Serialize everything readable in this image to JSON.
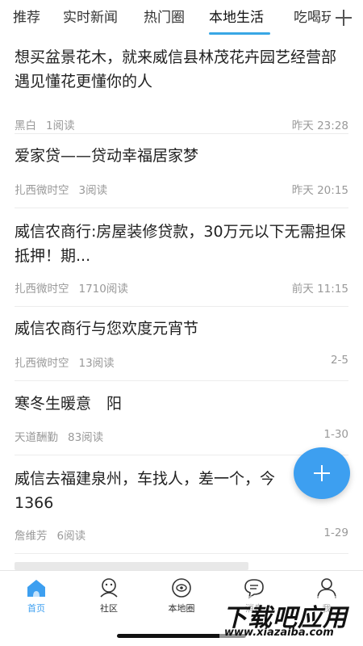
{
  "tabs": [
    {
      "label": "推荐"
    },
    {
      "label": "实时新闻"
    },
    {
      "label": "热门圈"
    },
    {
      "label": "本地生活",
      "active": true
    },
    {
      "label": "吃喝玩"
    }
  ],
  "feed": [
    {
      "title": "想买盆景花木，就来威信县林茂花卉园艺经营部遇见懂花更懂你的人",
      "author": "黑白",
      "views": "1阅读",
      "time": "昨天 23:28"
    },
    {
      "title": "爱家贷——贷动幸福居家梦",
      "author": "扎西微时空",
      "views": "3阅读",
      "time": "昨天 20:15"
    },
    {
      "title": "威信农商行:房屋装修贷款，30万元以下无需担保抵押！期...",
      "author": "扎西微时空",
      "views": "1710阅读",
      "time": "前天 11:15"
    },
    {
      "title": "威信农商行与您欢度元宵节",
      "author": "扎西微时空",
      "views": "13阅读",
      "time": "2-5"
    },
    {
      "title": "寒冬生暖意　阳",
      "author": "天道酬勤",
      "views": "83阅读",
      "time": "1-30"
    },
    {
      "title": "威信去福建泉州，车找人，差一个，今　　　走1366",
      "author": "詹维芳",
      "views": "6阅读",
      "time": "1-29"
    }
  ],
  "bottom_nav": [
    {
      "label": "首页",
      "icon": "home-icon",
      "active": true
    },
    {
      "label": "社区",
      "icon": "community-icon"
    },
    {
      "label": "本地圈",
      "icon": "local-circle-icon"
    },
    {
      "label": "消息",
      "icon": "message-icon"
    },
    {
      "label": "我",
      "icon": "profile-icon"
    }
  ],
  "watermark": {
    "main": "下载吧应用",
    "sub": "www.xiazaiba.com"
  },
  "colors": {
    "accent": "#39a7e5",
    "fab": "#3d9ff0",
    "meta_text": "#999999"
  }
}
